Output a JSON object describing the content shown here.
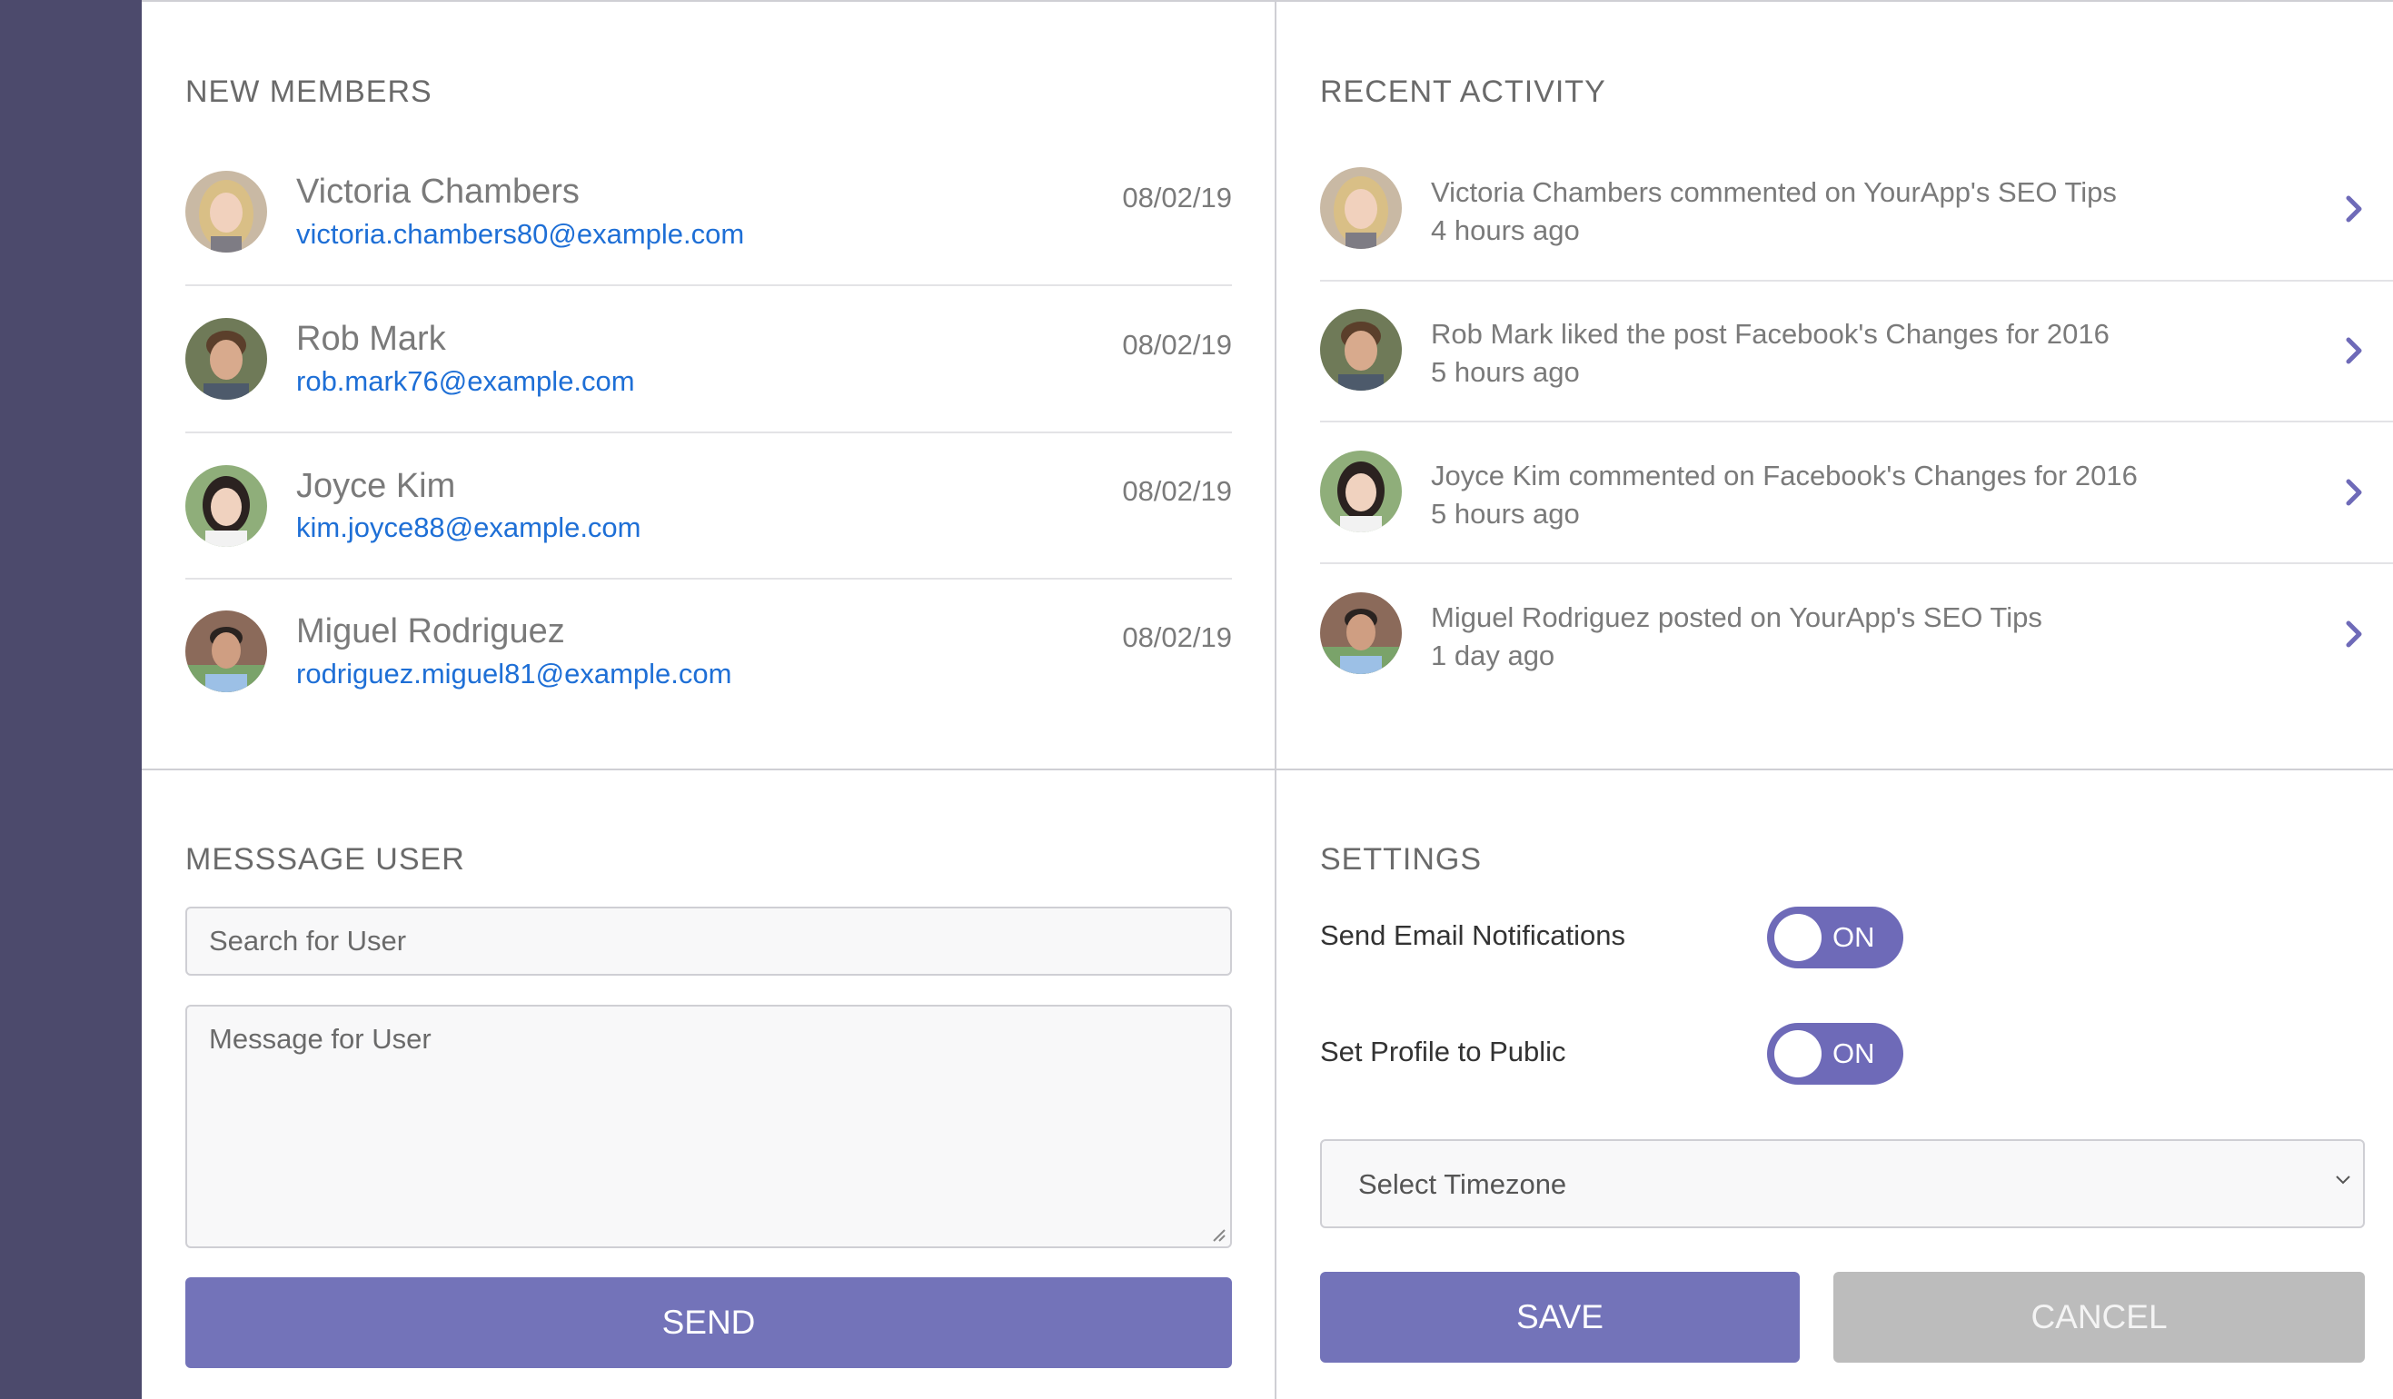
{
  "new_members": {
    "title": "NEW MEMBERS",
    "items": [
      {
        "name": "Victoria Chambers",
        "email": "victoria.chambers80@example.com",
        "date": "08/02/19"
      },
      {
        "name": "Rob Mark",
        "email": "rob.mark76@example.com",
        "date": "08/02/19"
      },
      {
        "name": "Joyce Kim",
        "email": "kim.joyce88@example.com",
        "date": "08/02/19"
      },
      {
        "name": "Miguel Rodriguez",
        "email": "rodriguez.miguel81@example.com",
        "date": "08/02/19"
      }
    ]
  },
  "recent_activity": {
    "title": "RECENT ACTIVITY",
    "items": [
      {
        "text": "Victoria Chambers commented on YourApp's SEO Tips",
        "time": "4 hours ago"
      },
      {
        "text": "Rob Mark liked the post Facebook's Changes for 2016",
        "time": "5 hours ago"
      },
      {
        "text": "Joyce Kim commented on Facebook's Changes for 2016",
        "time": "5 hours ago"
      },
      {
        "text": "Miguel Rodriguez posted on YourApp's SEO Tips",
        "time": "1 day ago"
      }
    ]
  },
  "message_user": {
    "title": "MESSSAGE USER",
    "search_placeholder": "Search for User",
    "message_placeholder": "Message for User",
    "send_label": "SEND"
  },
  "settings": {
    "title": "SETTINGS",
    "email_notifications_label": "Send Email Notifications",
    "email_notifications_state": "ON",
    "public_profile_label": "Set Profile to Public",
    "public_profile_state": "ON",
    "timezone_value": "Select Timezone",
    "save_label": "SAVE",
    "cancel_label": "CANCEL"
  },
  "colors": {
    "sidebar": "#4c4a6c",
    "accent": "#7373b9",
    "link": "#1e6fd6",
    "cancel": "#bcbcbc"
  }
}
